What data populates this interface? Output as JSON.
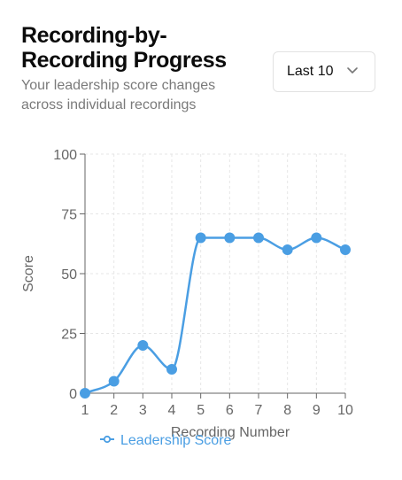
{
  "header": {
    "title": "Recording-by-Recording Progress",
    "subtitle": "Your leadership score changes across individual recordings"
  },
  "filter": {
    "selected": "Last 10",
    "icon": "chevron-down-icon"
  },
  "colors": {
    "series": "#4a9ee3",
    "axis": "#666666",
    "grid": "#e6e6e6"
  },
  "chart_data": {
    "type": "line",
    "xlabel": "Recording Number",
    "ylabel": "Score",
    "x": [
      1,
      2,
      3,
      4,
      5,
      6,
      7,
      8,
      9,
      10
    ],
    "yticks": [
      0,
      25,
      50,
      75,
      100
    ],
    "ylim": [
      0,
      100
    ],
    "grid": true,
    "legend_position": "bottom",
    "series": [
      {
        "name": "Leadership Score",
        "values": [
          0,
          5,
          20,
          10,
          65,
          65,
          65,
          60,
          65,
          60
        ]
      }
    ]
  }
}
